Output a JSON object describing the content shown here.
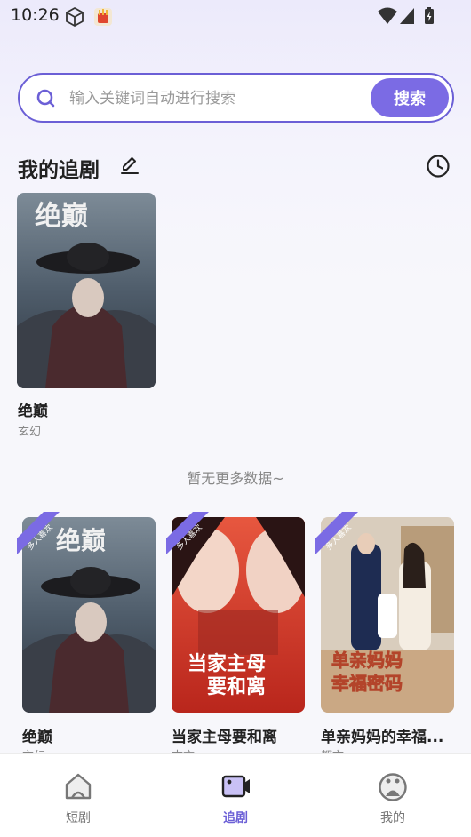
{
  "status_bar": {
    "time": "10:26"
  },
  "search": {
    "placeholder": "输入关键词自动进行搜索",
    "value": "",
    "button_label": "搜索"
  },
  "my_follow": {
    "title": "我的追剧",
    "items": [
      {
        "title": "绝巅",
        "genre": "玄幻"
      }
    ],
    "empty_hint": "暂无更多数据~"
  },
  "recommend": {
    "badge": "多人喜欢",
    "items": [
      {
        "title": "绝巅",
        "genre": "玄幻",
        "poster_text": "绝巅"
      },
      {
        "title": "当家主母要和离",
        "genre": "古言",
        "poster_text": "当家主母\n要和离"
      },
      {
        "title": "单亲妈妈的幸福...",
        "genre": "都市",
        "poster_text": "单亲妈妈\n幸福密码"
      }
    ]
  },
  "bottom_nav": {
    "items": [
      {
        "label": "短剧",
        "icon": "house-icon",
        "active": false
      },
      {
        "label": "追剧",
        "icon": "video-icon",
        "active": true
      },
      {
        "label": "我的",
        "icon": "profile-icon",
        "active": false
      }
    ]
  },
  "colors": {
    "accent": "#7b6be4",
    "text": "#222222",
    "muted": "#888888"
  }
}
